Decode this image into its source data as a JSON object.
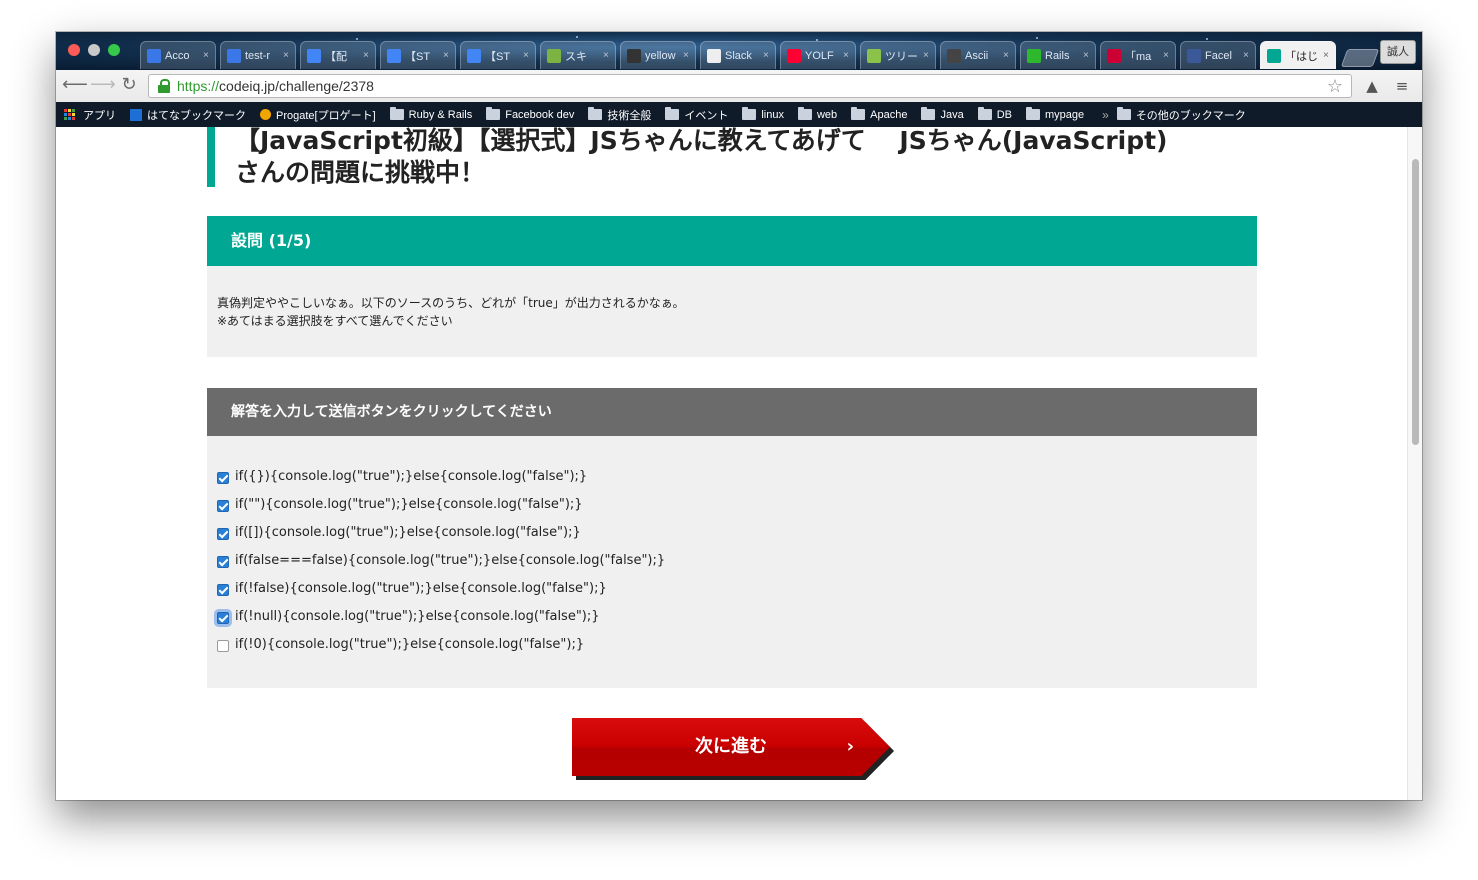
{
  "browser": {
    "tabs": [
      {
        "label": "Acco",
        "icon": "cloud-icon",
        "color": "#3b78e7"
      },
      {
        "label": "test-r",
        "icon": "cloud-icon",
        "color": "#3b78e7"
      },
      {
        "label": "【配",
        "icon": "doc-icon",
        "color": "#4285f4"
      },
      {
        "label": "【ST",
        "icon": "doc-icon",
        "color": "#4285f4"
      },
      {
        "label": "【ST",
        "icon": "doc-icon",
        "color": "#4285f4"
      },
      {
        "label": "スキ",
        "icon": "st-icon",
        "color": "#7cb342"
      },
      {
        "label": "yellow",
        "icon": "github-icon",
        "color": "#333333"
      },
      {
        "label": "Slack",
        "icon": "slack-icon",
        "color": "#eeeeee"
      },
      {
        "label": "YOLF",
        "icon": "yahoo-icon",
        "color": "#ff0033"
      },
      {
        "label": "ツリー",
        "icon": "tree-icon",
        "color": "#8bc34a"
      },
      {
        "label": "Ascii",
        "icon": "c-icon",
        "color": "#444444"
      },
      {
        "label": "Rails",
        "icon": "q-icon",
        "color": "#2eb82e"
      },
      {
        "label": "「ma",
        "icon": "pin-icon",
        "color": "#cc0033"
      },
      {
        "label": "Facel",
        "icon": "facebook-icon",
        "color": "#3b5998"
      },
      {
        "label": "「はじ",
        "icon": "codeiq-icon",
        "color": "#00a894",
        "active": true
      }
    ],
    "profile": "誠人",
    "url_scheme": "https://",
    "url_rest": "codeiq.jp/challenge/2378",
    "bookmarks": [
      {
        "label": "アプリ",
        "icon": "apps-grid-icon"
      },
      {
        "label": "はてなブックマーク",
        "icon": "hatena-icon"
      },
      {
        "label": "Progate[プロゲート]",
        "icon": "progate-icon"
      },
      {
        "label": "Ruby & Rails",
        "icon": "folder-icon"
      },
      {
        "label": "Facebook dev",
        "icon": "folder-icon"
      },
      {
        "label": "技術全般",
        "icon": "folder-icon"
      },
      {
        "label": "イベント",
        "icon": "folder-icon"
      },
      {
        "label": "linux",
        "icon": "folder-icon"
      },
      {
        "label": "web",
        "icon": "folder-icon"
      },
      {
        "label": "Apache",
        "icon": "folder-icon"
      },
      {
        "label": "Java",
        "icon": "folder-icon"
      },
      {
        "label": "DB",
        "icon": "folder-icon"
      },
      {
        "label": "mypage",
        "icon": "folder-icon"
      }
    ],
    "bookmarks_more": "»",
    "bookmarks_other": "その他のブックマーク"
  },
  "page": {
    "title_line1": "【JavaScript初級】【選択式】JSちゃんに教えてあげて　 JSちゃん(JavaScript)",
    "title_line2": "さんの問題に挑戦中！",
    "question_header": "設問 (1/5)",
    "question_line1": "真偽判定ややこしいなぁ。以下のソースのうち、どれが「true」が出力されるかなぁ。",
    "question_line2": "※あてはまる選択肢をすべて選んでください",
    "answer_header": "解答を入力して送信ボタンをクリックしてください",
    "choices": [
      {
        "label": "if({}){console.log(\"true\");}else{console.log(\"false\");}",
        "checked": true
      },
      {
        "label": "if(\"\"){console.log(\"true\");}else{console.log(\"false\");}",
        "checked": true
      },
      {
        "label": "if([]){console.log(\"true\");}else{console.log(\"false\");}",
        "checked": true
      },
      {
        "label": "if(false===false){console.log(\"true\");}else{console.log(\"false\");}",
        "checked": true
      },
      {
        "label": "if(!false){console.log(\"true\");}else{console.log(\"false\");}",
        "checked": true
      },
      {
        "label": "if(!null){console.log(\"true\");}else{console.log(\"false\");}",
        "checked": true,
        "focused": true
      },
      {
        "label": "if(!0){console.log(\"true\");}else{console.log(\"false\");}",
        "checked": false
      }
    ],
    "next_button": "次に進む",
    "next_arrow": "›"
  },
  "colors": {
    "accent": "#00a894",
    "answer_header": "#6b6b6b",
    "panel": "#f0f0f0",
    "button": "#c90000"
  }
}
